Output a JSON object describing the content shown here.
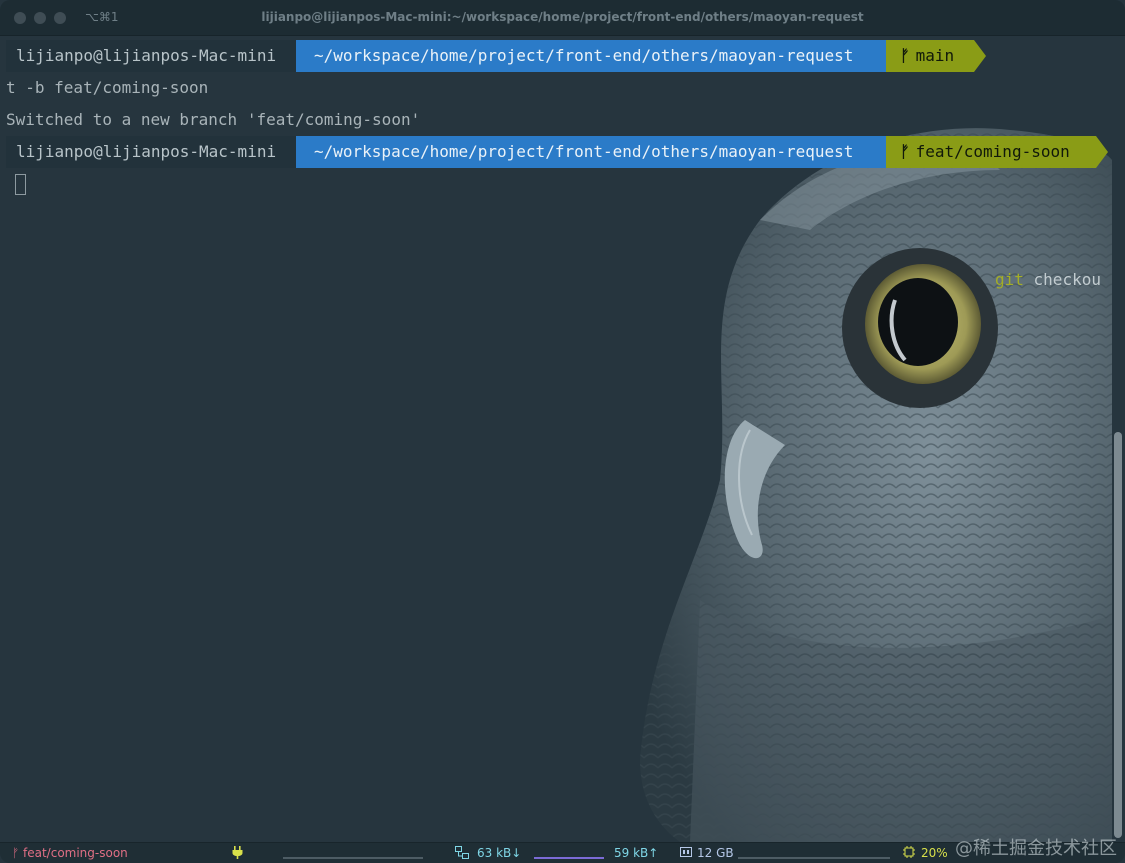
{
  "window": {
    "shortcut": "⌥⌘1",
    "title": "lijianpo@lijianpos-Mac-mini:~/workspace/home/project/front-end/others/maoyan-request"
  },
  "prompt1": {
    "user": "lijianpo@lijianpos-Mac-mini",
    "dir": "~/workspace/home/project/front-end/others/maoyan-request",
    "branch": "main",
    "branch_symbol": "ᚠ",
    "cmd_git": "git",
    "cmd_rest": " checkou"
  },
  "output": {
    "wrap": "t -b feat/coming-soon",
    "message": "Switched to a new branch 'feat/coming-soon'"
  },
  "prompt2": {
    "user": "lijianpo@lijianpos-Mac-mini",
    "dir": "~/workspace/home/project/front-end/others/maoyan-request",
    "branch": "feat/coming-soon",
    "branch_symbol": "ᚠ"
  },
  "status": {
    "branch": "ᚠ feat/coming-soon",
    "power_icon": "plug-icon",
    "net_icon": "network-icon",
    "download": "63 kB↓",
    "upload": "59 kB↑",
    "memory_icon": "memory-icon",
    "memory": "12 GB",
    "cpu_icon": "cpu-icon",
    "cpu": "20%"
  },
  "watermark": "@稀土掘金技术社区",
  "colors": {
    "background": "#26353e",
    "dir_segment": "#2b7bc8",
    "branch_segment": "#8a9c16",
    "command": "#a4ae26"
  }
}
